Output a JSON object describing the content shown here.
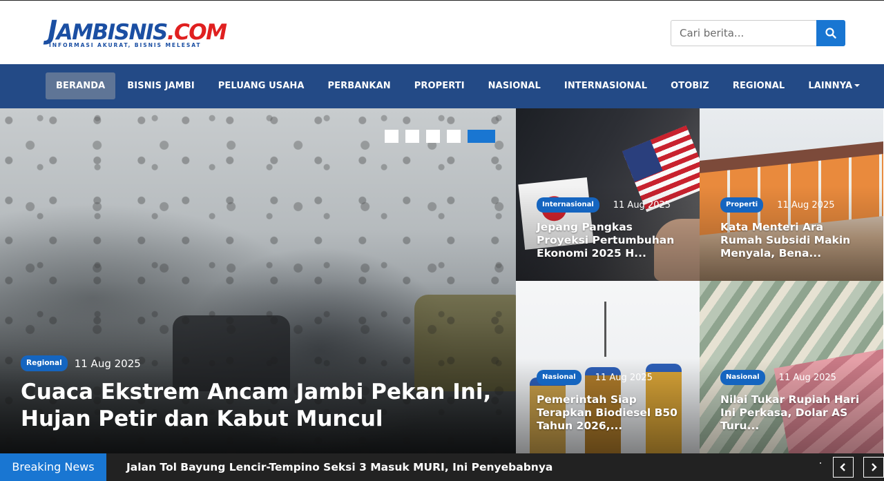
{
  "header": {
    "logo_text_j": "J",
    "logo_text_main": "AMBISNIS",
    "logo_text_com": ".COM",
    "logo_tagline": "INFORMASI AKURAT, BISNIS MELESAT",
    "search_placeholder": "Cari berita...",
    "search_icon": "search-icon"
  },
  "nav": {
    "items": [
      {
        "label": "BERANDA",
        "active": true
      },
      {
        "label": "BISNIS JAMBI"
      },
      {
        "label": "PELUANG USAHA"
      },
      {
        "label": "PERBANKAN"
      },
      {
        "label": "PROPERTI"
      },
      {
        "label": "NASIONAL"
      },
      {
        "label": "INTERNASIONAL"
      },
      {
        "label": "OTOBIZ"
      },
      {
        "label": "REGIONAL"
      },
      {
        "label": "LAINNYA",
        "dropdown": true
      }
    ]
  },
  "hero": {
    "category": "Regional",
    "date": "11 Aug 2025",
    "title": "Cuaca Ekstrem Ancam Jambi Pekan Ini, Hujan Petir dan Kabut Muncul",
    "slide_count": 5,
    "active_slide": 5
  },
  "cards": [
    {
      "category": "Internasional",
      "date": "11 Aug 2025",
      "title": "Jepang Pangkas Proyeksi Pertumbuhan Ekonomi 2025 H..."
    },
    {
      "category": "Properti",
      "date": "11 Aug 2025",
      "title": "Kata Menteri Ara Rumah Subsidi Makin Menyala, Bena..."
    },
    {
      "category": "Nasional",
      "date": "11 Aug 2025",
      "title": "Pemerintah Siap Terapkan Biodiesel B50 Tahun 2026,..."
    },
    {
      "category": "Nasional",
      "date": "11 Aug 2025",
      "title": "Nilai Tukar Rupiah Hari Ini Perkasa, Dolar AS Turu..."
    }
  ],
  "ticker": {
    "label": "Breaking News",
    "headline": "Jalan Tol Bayung Lencir-Tempino Seksi 3 Masuk MURI, Ini Penyebabnya",
    "prev_icon": "chevron-left-icon",
    "next_icon": "chevron-right-icon"
  },
  "colors": {
    "nav_bg": "#234a86",
    "accent": "#1976d2",
    "badge": "#1565c0",
    "logo_blue": "#1b4fa3",
    "logo_red": "#e02020"
  }
}
